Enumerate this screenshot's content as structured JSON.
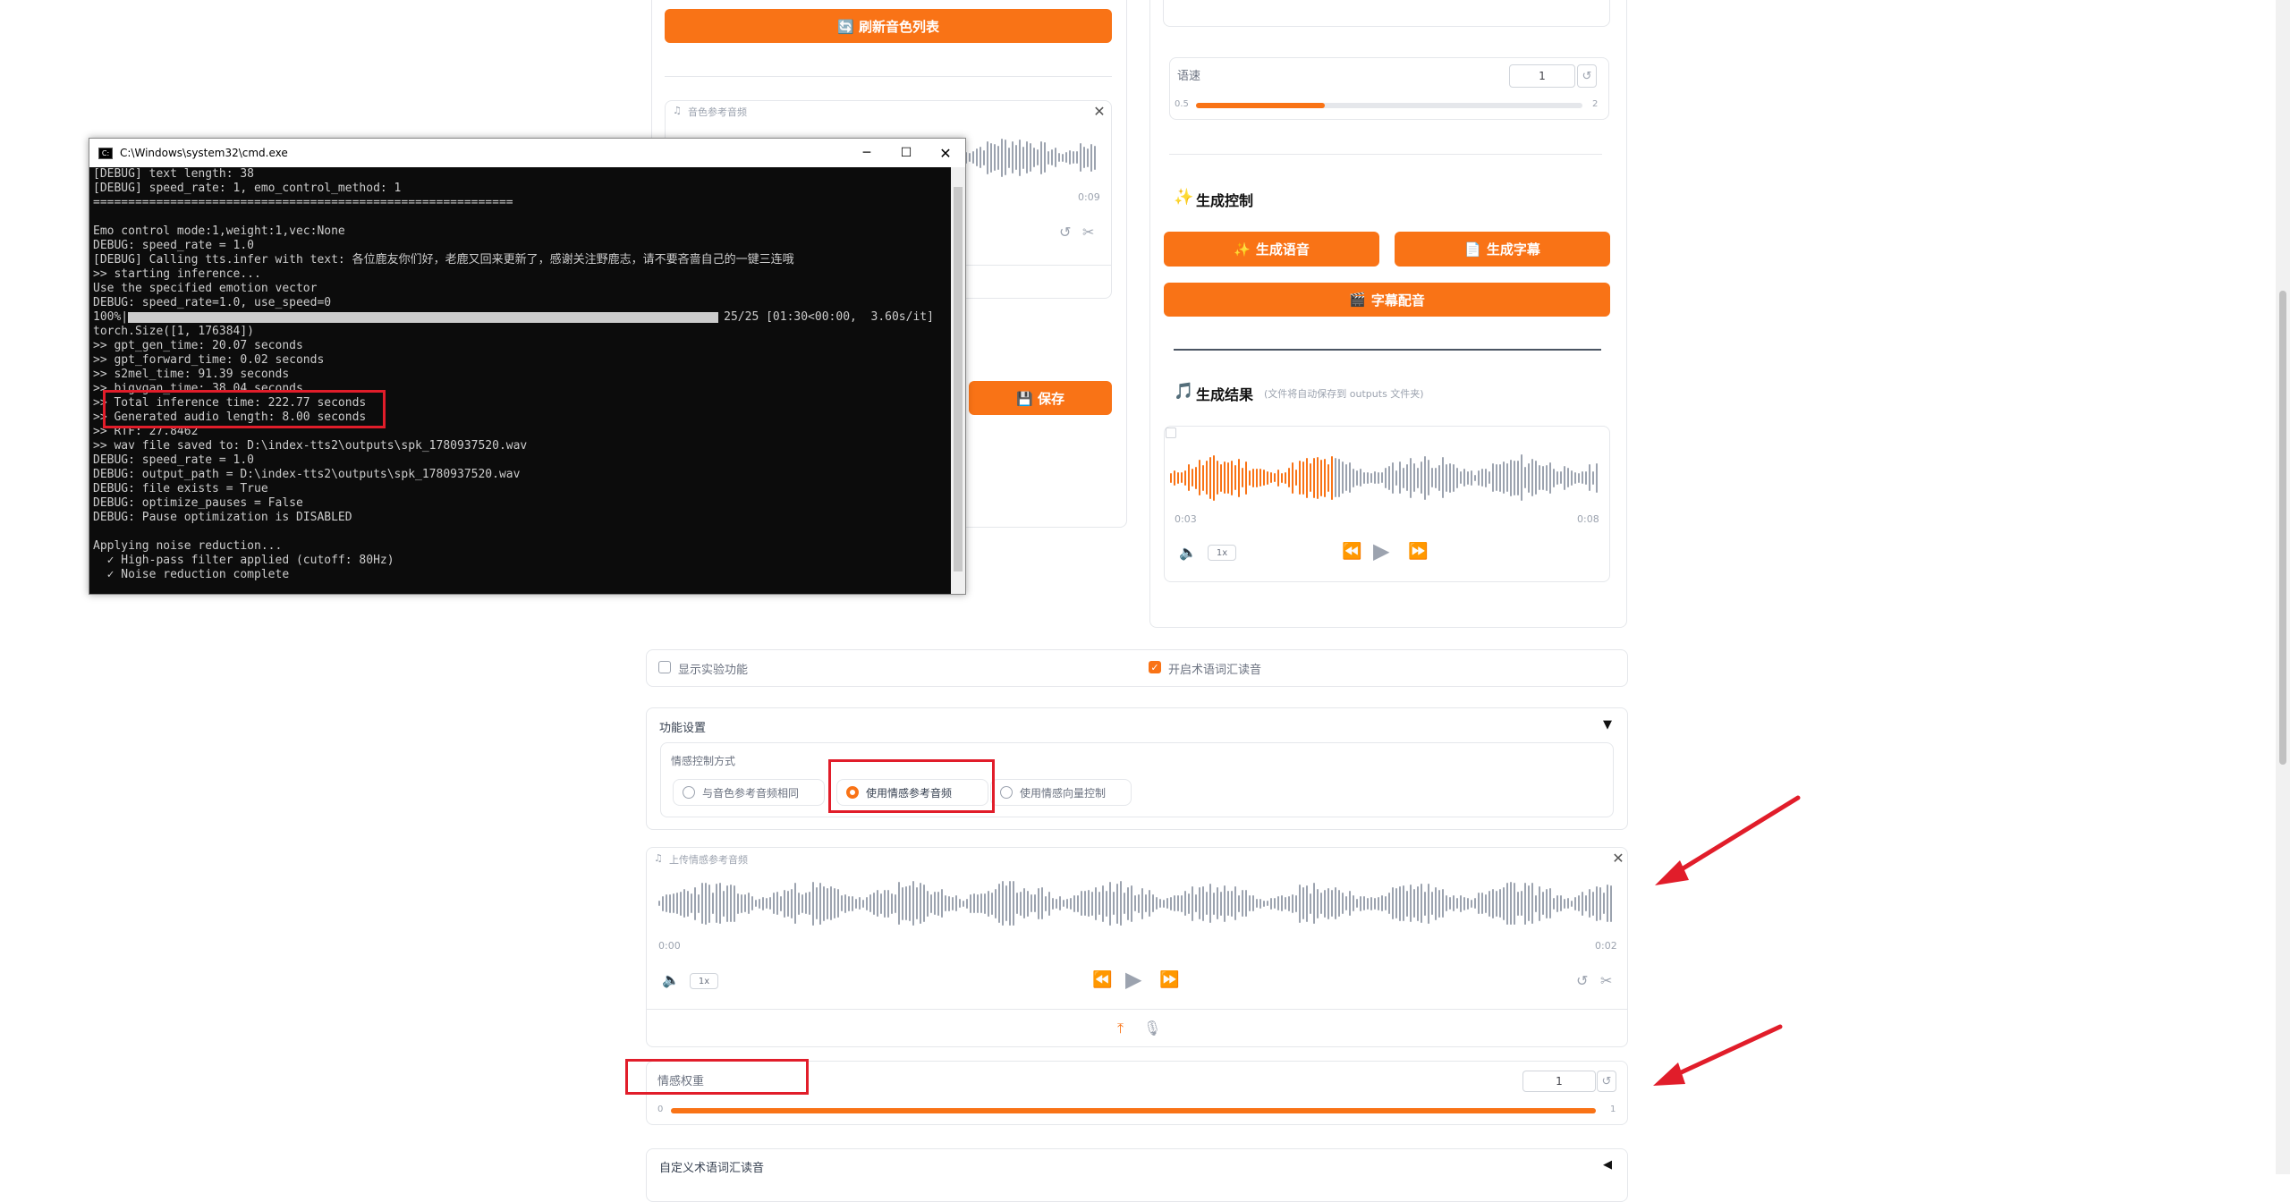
{
  "left_panel": {
    "refresh_button": "🔄 刷新音色列表",
    "ref_audio_label": "音色参考音频",
    "ref_audio_time_end": "0:09",
    "save_button": "💾 保存"
  },
  "right_panel": {
    "speed_label": "语速",
    "speed_value": "1",
    "speed_min": "0.5",
    "speed_max": "2",
    "speed_fraction": 0.333,
    "gen_control_title": "生成控制",
    "gen_speech_button": "生成语音",
    "gen_subtitle_button": "生成字幕",
    "subtitle_dub_button": "字幕配音",
    "result_title": "生成结果",
    "result_note": "(文件将自动保存到 outputs 文件夹)",
    "result_time_start": "0:03",
    "result_time_end": "0:08",
    "result_speed": "1x",
    "result_progress_fraction": 0.38
  },
  "toggles": {
    "experimental_label": "显示实验功能",
    "experimental_checked": false,
    "term_reading_label": "开启术语词汇读音",
    "term_reading_checked": true
  },
  "feature_settings": {
    "title": "功能设置",
    "emo_method_label": "情感控制方式",
    "options": [
      {
        "label": "与音色参考音频相同",
        "checked": false
      },
      {
        "label": "使用情感参考音频",
        "checked": true
      },
      {
        "label": "使用情感向量控制",
        "checked": false
      }
    ]
  },
  "emo_audio": {
    "label": "上传情感参考音频",
    "time_start": "0:00",
    "time_end": "0:02",
    "speed": "1x"
  },
  "emo_weight": {
    "label": "情感权重",
    "value": "1",
    "min": "0",
    "max": "1",
    "fraction": 1.0
  },
  "custom_terms": {
    "title": "自定义术语词汇读音"
  },
  "console": {
    "title": "C:\\Windows\\system32\\cmd.exe",
    "lines": [
      "[DEBUG] text length: 38",
      "[DEBUG] speed_rate: 1, emo_control_method: 1",
      "============================================================",
      "",
      "Emo control mode:1,weight:1,vec:None",
      "DEBUG: speed_rate = 1.0",
      "[DEBUG] Calling tts.infer with text: 各位鹿友你们好，老鹿又回来更新了，感谢关注野鹿志，请不要吝啬自己的一键三连哦",
      ">> starting inference...",
      "Use the specified emotion vector",
      "DEBUG: speed_rate=1.0, use_speed=0",
      "100%|",
      "torch.Size([1, 176384])",
      ">> gpt_gen_time: 20.07 seconds",
      ">> gpt_forward_time: 0.02 seconds",
      ">> s2mel_time: 91.39 seconds",
      ">> bigvgan_time: 38.04 seconds",
      ">> Total inference time: 222.77 seconds",
      ">> Generated audio length: 8.00 seconds",
      ">> RTF: 27.8462",
      ">> wav file saved to: D:\\index-tts2\\outputs\\spk_1780937520.wav",
      "DEBUG: speed_rate = 1.0",
      "DEBUG: output_path = D:\\index-tts2\\outputs\\spk_1780937520.wav",
      "DEBUG: file exists = True",
      "DEBUG: optimize_pauses = False",
      "DEBUG: Pause optimization is DISABLED",
      "",
      "Applying noise reduction...",
      "  ✓ High-pass filter applied (cutoff: 80Hz)",
      "  ✓ Noise reduction complete"
    ],
    "progress_text": "25/25 [01:30<00:00,  3.60s/it]",
    "progress_fraction": 1.0
  },
  "colors": {
    "accent": "#f97316",
    "highlight": "#e11d2a"
  }
}
